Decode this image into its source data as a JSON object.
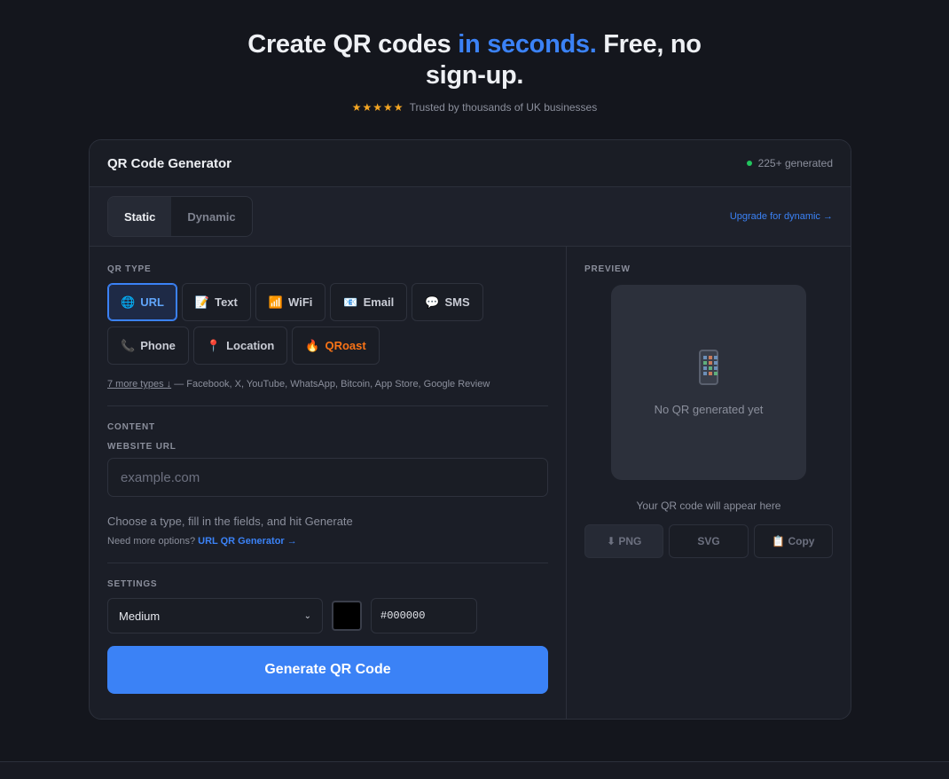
{
  "hero": {
    "title_part1": "Create QR codes ",
    "title_accent": "in seconds.",
    "title_part2": " Free, no sign-up.",
    "stars": "★★★★★",
    "trust_text": "Trusted by thousands of UK businesses"
  },
  "card": {
    "title": "QR Code Generator",
    "generated_count": "225+ generated"
  },
  "mode": {
    "tabs": [
      {
        "label": "Static",
        "active": true
      },
      {
        "label": "Dynamic",
        "active": false
      }
    ],
    "upgrade_link": "Upgrade for dynamic →"
  },
  "qr_type": {
    "section_label": "QR TYPE",
    "types": [
      {
        "emoji": "🌐",
        "label": "URL",
        "active": true
      },
      {
        "emoji": "📝",
        "label": "Text"
      },
      {
        "emoji": "📶",
        "label": "WiFi"
      },
      {
        "emoji": "📧",
        "label": "Email"
      },
      {
        "emoji": "💬",
        "label": "SMS"
      },
      {
        "emoji": "📞",
        "label": "Phone"
      },
      {
        "emoji": "📍",
        "label": "Location"
      },
      {
        "emoji": "🔥",
        "label": "QRoast"
      }
    ],
    "more_types_link": "7 more types ↓",
    "more_types_list": " — Facebook, X, YouTube, WhatsApp, Bitcoin, App Store, Google Review"
  },
  "content": {
    "section_label": "CONTENT",
    "field_label": "WEBSITE URL",
    "placeholder": "example.com",
    "value": "",
    "hint": "Choose a type, fill in the fields, and hit Generate",
    "more_options_text": "Need more options? ",
    "more_options_link": "URL QR Generator →"
  },
  "settings": {
    "section_label": "SETTINGS",
    "size_selected": "Medium",
    "color_hex": "#000000"
  },
  "generate_button": "Generate QR Code",
  "preview": {
    "section_label": "PREVIEW",
    "empty_text": "No QR generated yet",
    "appear_text": "Your QR code will appear here",
    "buttons": [
      "⬇ PNG",
      "SVG",
      "📋 Copy"
    ]
  },
  "colors": {
    "accent": "#3b82f6",
    "background": "#14161d",
    "card": "#1b1e27",
    "status_green": "#22c55e",
    "star": "#f5a623"
  }
}
